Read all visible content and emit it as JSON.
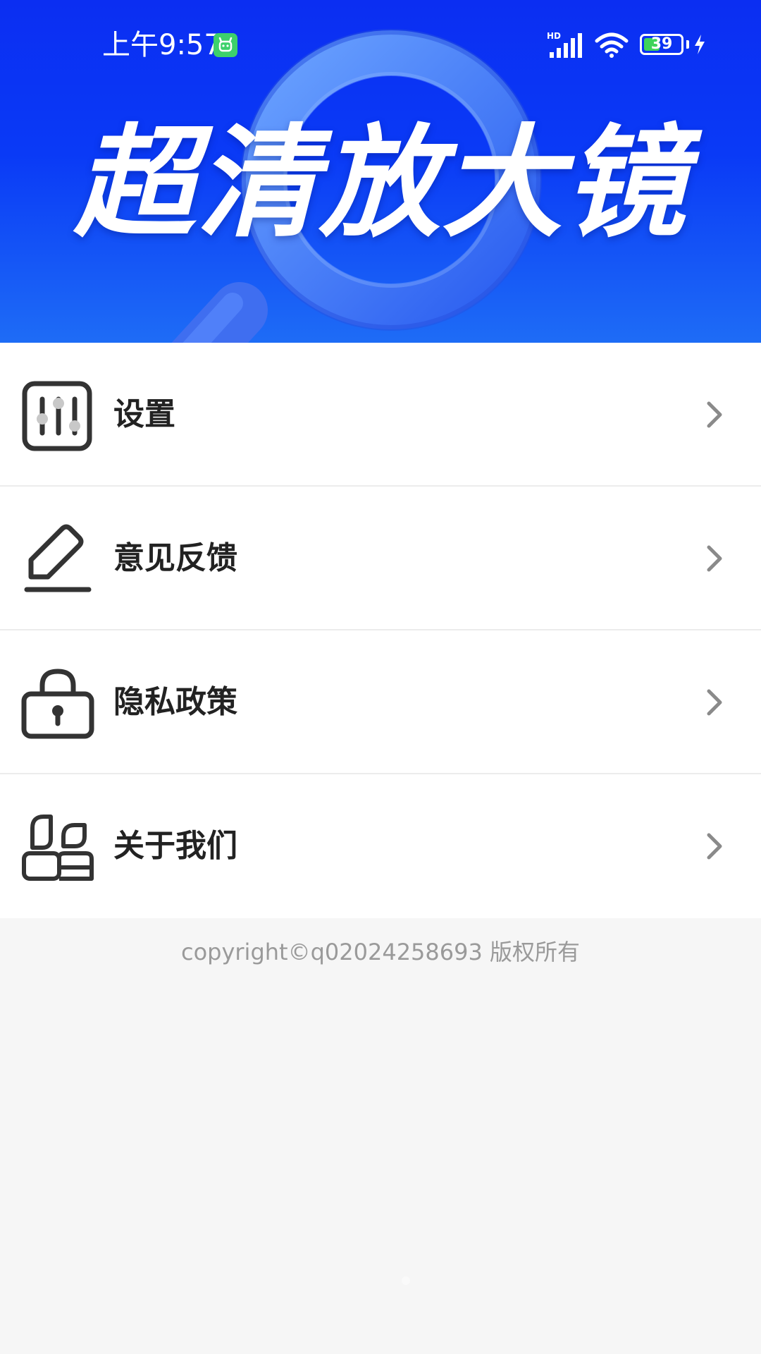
{
  "status_bar": {
    "time": "上午9:57",
    "network": "HD",
    "battery": "39"
  },
  "banner": {
    "title": "超清放大镜"
  },
  "menu": {
    "items": [
      {
        "label": "设置",
        "icon": "settings-sliders-icon"
      },
      {
        "label": "意见反馈",
        "icon": "pen-edit-icon"
      },
      {
        "label": "隐私政策",
        "icon": "lock-icon"
      },
      {
        "label": "关于我们",
        "icon": "people-icon"
      }
    ]
  },
  "footer": {
    "copyright": "copyright©q02024258693 版权所有"
  },
  "colors": {
    "banner_top": "#0b2ef2",
    "banner_bottom": "#1e6cf6",
    "icon_stroke": "#333333",
    "chevron": "#8a8a8a",
    "background": "#f6f6f6"
  }
}
